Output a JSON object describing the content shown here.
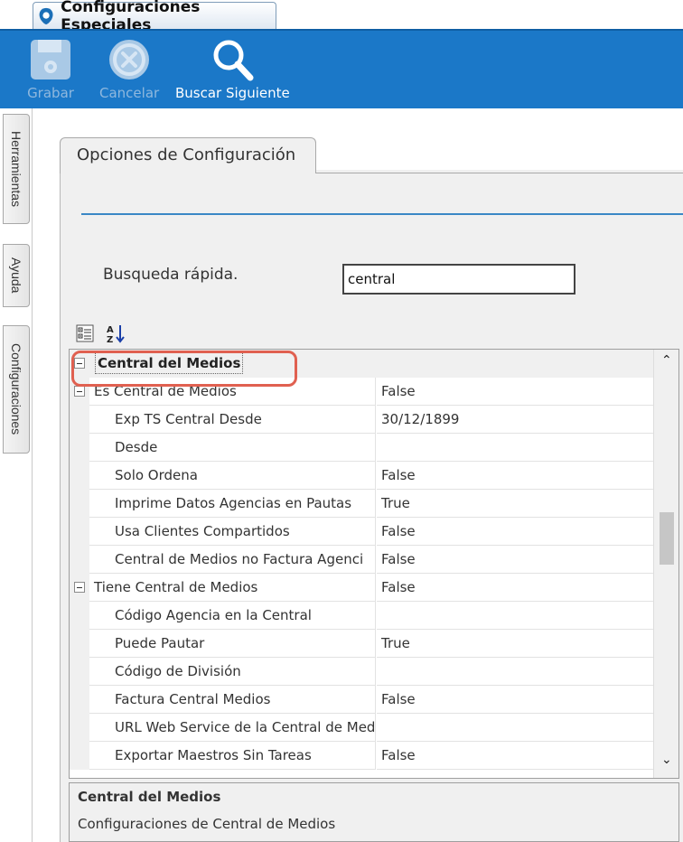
{
  "window_tab": {
    "title": "Configuraciones Especiales"
  },
  "toolbar": {
    "grabar": "Grabar",
    "cancelar": "Cancelar",
    "buscar_siguiente": "Buscar Siguiente"
  },
  "side_tabs": [
    "Herramientas",
    "Ayuda",
    "Configuraciones"
  ],
  "options_tab": {
    "label": "Opciones de Configuración"
  },
  "quick_search": {
    "label": "Busqueda rápida.",
    "value": "central"
  },
  "grid": {
    "category": "Central del Medios",
    "rows": [
      {
        "name": "Es Central de Medios",
        "value": "False"
      },
      {
        "name": "Exp TS Central Desde",
        "value": "30/12/1899"
      },
      {
        "name": "Desde",
        "value": ""
      },
      {
        "name": "Solo Ordena",
        "value": "False"
      },
      {
        "name": "Imprime Datos Agencias en Pautas",
        "value": "True"
      },
      {
        "name": "Usa Clientes Compartidos",
        "value": "False"
      },
      {
        "name": "Central de Medios no Factura Agenci",
        "value": "False"
      },
      {
        "name": "Tiene Central de Medios",
        "value": "False"
      },
      {
        "name": "Código Agencia en la Central",
        "value": ""
      },
      {
        "name": "Puede Pautar",
        "value": "True"
      },
      {
        "name": "Código de División",
        "value": ""
      },
      {
        "name": "Factura Central Medios",
        "value": "False"
      },
      {
        "name": "URL Web Service de la Central de Med",
        "value": ""
      },
      {
        "name": "Exportar Maestros Sin Tareas",
        "value": "False"
      }
    ]
  },
  "description": {
    "title": "Central del Medios",
    "text": "Configuraciones de Central de Medios"
  },
  "colors": {
    "toolbar": "#1b78c8",
    "accent": "#3a87c6",
    "highlight": "#e06050"
  }
}
